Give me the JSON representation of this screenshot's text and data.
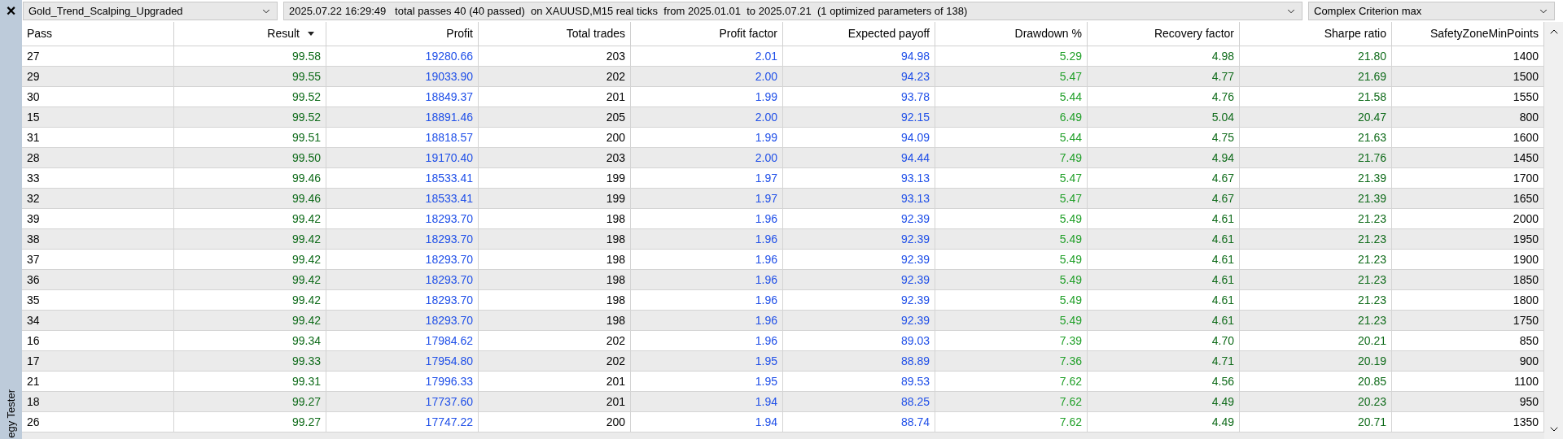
{
  "panel": {
    "close": "×",
    "side_label": "egy Tester"
  },
  "toolbar": {
    "expert": "Gold_Trend_Scalping_Upgraded",
    "summary": "2025.07.22 16:29:49   total passes 40 (40 passed)  on XAUUSD,M15 real ticks  from 2025.01.01  to 2025.07.21  (1 optimized parameters of 138)",
    "criterion": "Complex Criterion max"
  },
  "table": {
    "columns": [
      {
        "label": "Pass",
        "sorted": false,
        "color": "#000000"
      },
      {
        "label": "Result",
        "sorted": true,
        "color": "#0f6b1a"
      },
      {
        "label": "Profit",
        "sorted": false,
        "color": "#1f4fe8"
      },
      {
        "label": "Total trades",
        "sorted": false,
        "color": "#000000"
      },
      {
        "label": "Profit factor",
        "sorted": false,
        "color": "#1f4fe8"
      },
      {
        "label": "Expected payoff",
        "sorted": false,
        "color": "#1f4fe8"
      },
      {
        "label": "Drawdown %",
        "sorted": false,
        "color": "#22a02a"
      },
      {
        "label": "Recovery factor",
        "sorted": false,
        "color": "#0f6b1a"
      },
      {
        "label": "Sharpe ratio",
        "sorted": false,
        "color": "#0f6b1a"
      },
      {
        "label": "SafetyZoneMinPoints",
        "sorted": false,
        "color": "#000000"
      }
    ],
    "rows": [
      [
        "27",
        "99.58",
        "19280.66",
        "203",
        "2.01",
        "94.98",
        "5.29",
        "4.98",
        "21.80",
        "1400"
      ],
      [
        "29",
        "99.55",
        "19033.90",
        "202",
        "2.00",
        "94.23",
        "5.47",
        "4.77",
        "21.69",
        "1500"
      ],
      [
        "30",
        "99.52",
        "18849.37",
        "201",
        "1.99",
        "93.78",
        "5.44",
        "4.76",
        "21.58",
        "1550"
      ],
      [
        "15",
        "99.52",
        "18891.46",
        "205",
        "2.00",
        "92.15",
        "6.49",
        "5.04",
        "20.47",
        "800"
      ],
      [
        "31",
        "99.51",
        "18818.57",
        "200",
        "1.99",
        "94.09",
        "5.44",
        "4.75",
        "21.63",
        "1600"
      ],
      [
        "28",
        "99.50",
        "19170.40",
        "203",
        "2.00",
        "94.44",
        "7.49",
        "4.94",
        "21.76",
        "1450"
      ],
      [
        "33",
        "99.46",
        "18533.41",
        "199",
        "1.97",
        "93.13",
        "5.47",
        "4.67",
        "21.39",
        "1700"
      ],
      [
        "32",
        "99.46",
        "18533.41",
        "199",
        "1.97",
        "93.13",
        "5.47",
        "4.67",
        "21.39",
        "1650"
      ],
      [
        "39",
        "99.42",
        "18293.70",
        "198",
        "1.96",
        "92.39",
        "5.49",
        "4.61",
        "21.23",
        "2000"
      ],
      [
        "38",
        "99.42",
        "18293.70",
        "198",
        "1.96",
        "92.39",
        "5.49",
        "4.61",
        "21.23",
        "1950"
      ],
      [
        "37",
        "99.42",
        "18293.70",
        "198",
        "1.96",
        "92.39",
        "5.49",
        "4.61",
        "21.23",
        "1900"
      ],
      [
        "36",
        "99.42",
        "18293.70",
        "198",
        "1.96",
        "92.39",
        "5.49",
        "4.61",
        "21.23",
        "1850"
      ],
      [
        "35",
        "99.42",
        "18293.70",
        "198",
        "1.96",
        "92.39",
        "5.49",
        "4.61",
        "21.23",
        "1800"
      ],
      [
        "34",
        "99.42",
        "18293.70",
        "198",
        "1.96",
        "92.39",
        "5.49",
        "4.61",
        "21.23",
        "1750"
      ],
      [
        "16",
        "99.34",
        "17984.62",
        "202",
        "1.96",
        "89.03",
        "7.39",
        "4.70",
        "20.21",
        "850"
      ],
      [
        "17",
        "99.33",
        "17954.80",
        "202",
        "1.95",
        "88.89",
        "7.36",
        "4.71",
        "20.19",
        "900"
      ],
      [
        "21",
        "99.31",
        "17996.33",
        "201",
        "1.95",
        "89.53",
        "7.62",
        "4.56",
        "20.85",
        "1100"
      ],
      [
        "18",
        "99.27",
        "17737.60",
        "201",
        "1.94",
        "88.25",
        "7.62",
        "4.49",
        "20.23",
        "950"
      ],
      [
        "26",
        "99.27",
        "17747.22",
        "200",
        "1.94",
        "88.74",
        "7.62",
        "4.49",
        "20.71",
        "1350"
      ]
    ]
  }
}
